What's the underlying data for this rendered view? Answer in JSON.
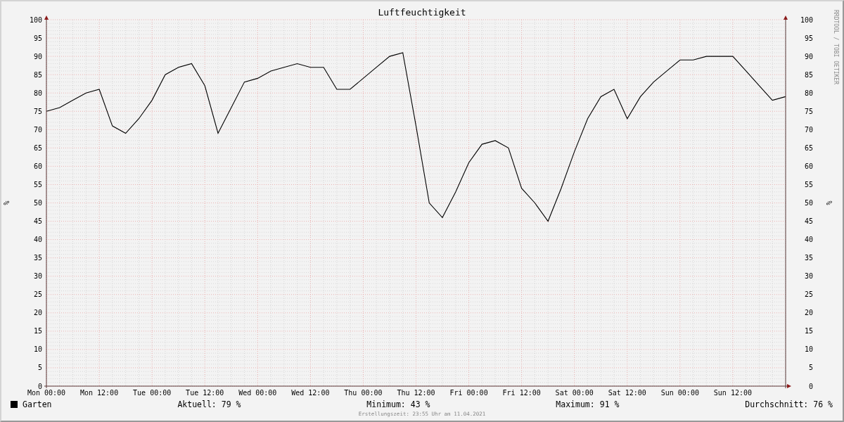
{
  "title": "Luftfeuchtigkeit",
  "credit": "RRDTOOL / TOBI OETIKER",
  "chart": {
    "right_ylabel": "%",
    "right_yticks": [
      "100",
      "95",
      "90",
      "85",
      "80",
      "75",
      "70",
      "65",
      "60",
      "55",
      "50",
      "45",
      "40",
      "35",
      "30",
      "25",
      "20",
      "15",
      "10",
      "5",
      "0"
    ],
    "chart_data": {
      "type": "line",
      "grid": true,
      "ylabel": "%",
      "ylim": [
        0,
        100
      ],
      "categories": [
        "Mon 00:00",
        null,
        null,
        null,
        "Mon 12:00",
        null,
        null,
        null,
        "Tue 00:00",
        null,
        null,
        null,
        "Tue 12:00",
        null,
        null,
        null,
        "Wed 00:00",
        null,
        null,
        null,
        "Wed 12:00",
        null,
        null,
        null,
        "Thu 00:00",
        null,
        null,
        null,
        "Thu 12:00",
        null,
        null,
        null,
        "Fri 00:00",
        null,
        null,
        null,
        "Fri 12:00",
        null,
        null,
        null,
        "Sat 00:00",
        null,
        null,
        null,
        "Sat 12:00",
        null,
        null,
        null,
        "Sun 00:00",
        null,
        null,
        null,
        "Sun 12:00",
        null,
        null,
        null,
        null
      ],
      "series": [
        {
          "name": "Garten",
          "color": "#000000",
          "values": [
            75,
            76,
            78,
            80,
            81,
            71,
            69,
            73,
            78,
            85,
            87,
            88,
            82,
            69,
            76,
            83,
            84,
            86,
            87,
            88,
            87,
            87,
            81,
            81,
            84,
            87,
            90,
            91,
            71,
            50,
            46,
            53,
            61,
            66,
            67,
            65,
            54,
            50,
            45,
            54,
            64,
            73,
            79,
            81,
            73,
            79,
            83,
            86,
            89,
            89,
            90,
            90,
            90,
            86,
            82,
            78,
            79
          ]
        }
      ],
      "yticks": [
        0,
        5,
        10,
        15,
        20,
        25,
        30,
        35,
        40,
        45,
        50,
        55,
        60,
        65,
        70,
        75,
        80,
        85,
        90,
        95,
        100
      ]
    }
  },
  "legend": {
    "stats": [
      {
        "label": "Aktuell:",
        "value": "79 %"
      },
      {
        "label": "Minimum:",
        "value": "43 %"
      },
      {
        "label": "Maximum:",
        "value": "91 %"
      },
      {
        "label": "Durchschnitt:",
        "value": "76 %"
      }
    ]
  },
  "footer": "Erstellungszeit: 23:55 Uhr am 11.04.2021"
}
